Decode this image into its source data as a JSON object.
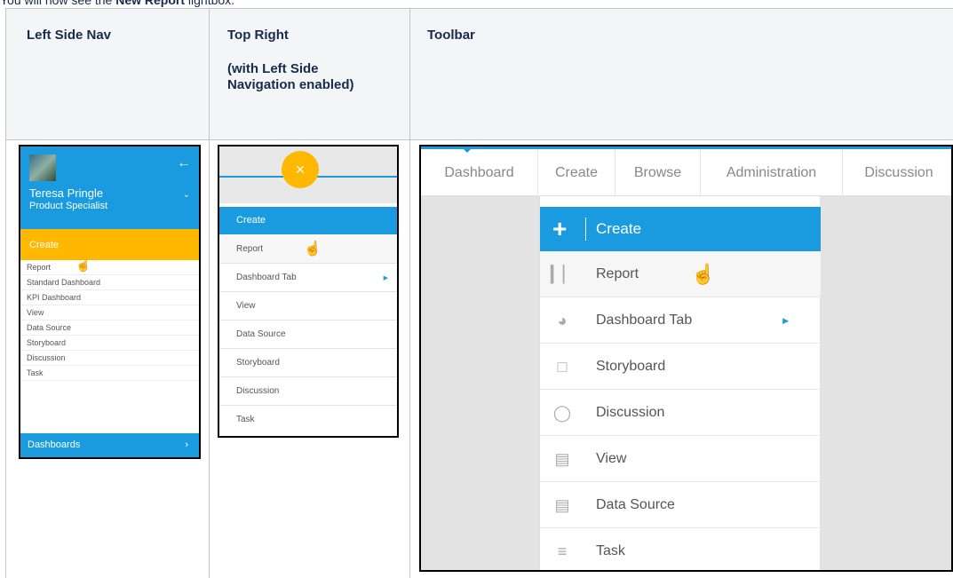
{
  "intro": {
    "prefix": "You will now see the ",
    "bold": "New Report",
    "suffix": " lightbox."
  },
  "table": {
    "headers": [
      "Left Side Nav",
      "Top Right",
      "Toolbar"
    ],
    "top_right_note": "(with Left Side Navigation enabled)"
  },
  "left_nav": {
    "user_name": "Teresa Pringle",
    "user_role": "Product Specialist",
    "create_label": "Create",
    "items": [
      "Report",
      "Standard Dashboard",
      "KPI Dashboard",
      "View",
      "Data Source",
      "Storyboard",
      "Discussion",
      "Task"
    ],
    "footer_label": "Dashboards"
  },
  "top_right": {
    "create_label": "Create",
    "items": [
      "Report",
      "Dashboard Tab",
      "View",
      "Data Source",
      "Storyboard",
      "Discussion",
      "Task"
    ]
  },
  "toolbar": {
    "tabs": [
      "Dashboard",
      "Create",
      "Browse",
      "Administration",
      "Discussion"
    ],
    "create_label": "Create",
    "items": [
      {
        "label": "Report",
        "icon": "bar-chart-icon"
      },
      {
        "label": "Dashboard Tab",
        "icon": "gauge-icon"
      },
      {
        "label": "Storyboard",
        "icon": "monitor-icon"
      },
      {
        "label": "Discussion",
        "icon": "chat-bubble-icon"
      },
      {
        "label": "View",
        "icon": "view-icon"
      },
      {
        "label": "Data Source",
        "icon": "data-source-icon"
      },
      {
        "label": "Task",
        "icon": "list-icon"
      }
    ]
  }
}
